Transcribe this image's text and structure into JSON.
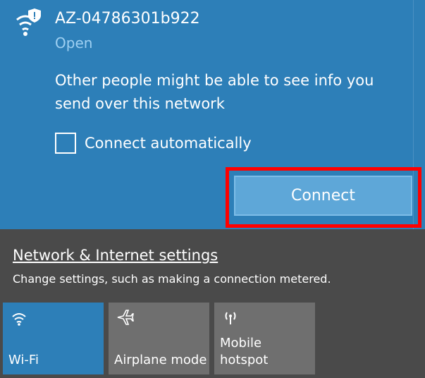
{
  "wifi": {
    "ssid": "AZ-04786301b922",
    "status": "Open",
    "warning": "Other people might be able to see info you send over this network",
    "auto_connect_label": "Connect automatically",
    "connect_label": "Connect",
    "icon": "wifi-secure-icon"
  },
  "network_settings": {
    "link_label": "Network & Internet settings",
    "description": "Change settings, such as making a connection metered."
  },
  "quick_actions": [
    {
      "label": "Wi-Fi",
      "icon": "wifi-icon"
    },
    {
      "label": "Airplane mode",
      "icon": "airplane-icon"
    },
    {
      "label_line1": "Mobile",
      "label_line2": "hotspot",
      "icon": "mobile-hotspot-icon"
    }
  ],
  "colors": {
    "accent": "#2d7fb8",
    "highlight": "#ff0000",
    "tile_inactive": "#6f6f6f",
    "background": "#4a4a4a"
  }
}
